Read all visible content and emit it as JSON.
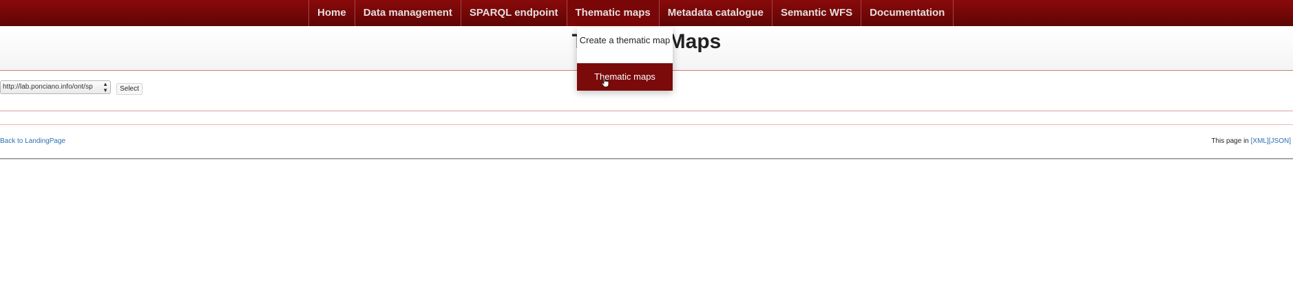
{
  "nav": {
    "items": [
      {
        "label": "Home"
      },
      {
        "label": "Data management"
      },
      {
        "label": "SPARQL endpoint"
      },
      {
        "label": "Thematic maps"
      },
      {
        "label": "Metadata catalogue"
      },
      {
        "label": "Semantic WFS"
      },
      {
        "label": "Documentation"
      }
    ]
  },
  "page": {
    "title": "Thematic Maps"
  },
  "dropdown": {
    "items": [
      {
        "label": "Create a thematic map"
      },
      {
        "label": "Thematic maps"
      }
    ]
  },
  "form": {
    "select_value": "http://lab.ponciano.info/ont/sp",
    "select_button": "Select"
  },
  "footer": {
    "back_link": "Back to LandingPage",
    "this_page_in": "This page in",
    "xml_link": "[XML]",
    "json_link": "[JSON]"
  },
  "colors": {
    "navbar": "#6e0606",
    "active_menu_item": "#7b0a0a",
    "link": "#2a6fb5"
  },
  "icons": {
    "select_arrows": "updown-arrows-icon",
    "cursor": "hand-pointer-icon"
  }
}
